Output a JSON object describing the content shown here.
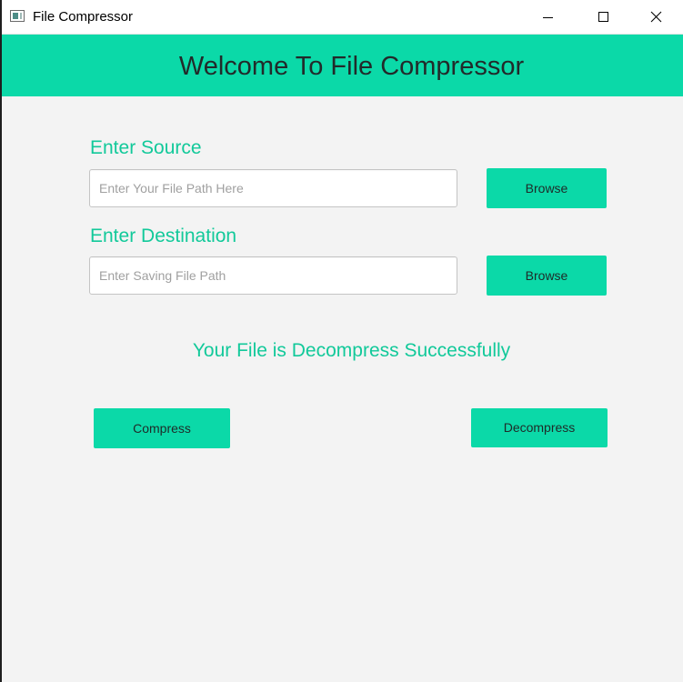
{
  "window": {
    "title": "File Compressor",
    "controls": {
      "minimize": "minimize-icon",
      "maximize": "maximize-icon",
      "close": "close-icon"
    }
  },
  "header": {
    "title": "Welcome To File Compressor",
    "background": "#0bd9a8"
  },
  "source": {
    "label": "Enter Source",
    "value": "",
    "placeholder": "Enter Your File Path Here",
    "browse_label": "Browse"
  },
  "destination": {
    "label": "Enter Destination",
    "value": "",
    "placeholder": "Enter Saving File Path",
    "browse_label": "Browse"
  },
  "status": {
    "message": "Your File is Decompress Successfully",
    "color": "#12c99a"
  },
  "actions": {
    "compress_label": "Compress",
    "decompress_label": "Decompress"
  },
  "colors": {
    "accent": "#0bd9a8",
    "label_text": "#12c99a",
    "background": "#f3f3f3"
  }
}
